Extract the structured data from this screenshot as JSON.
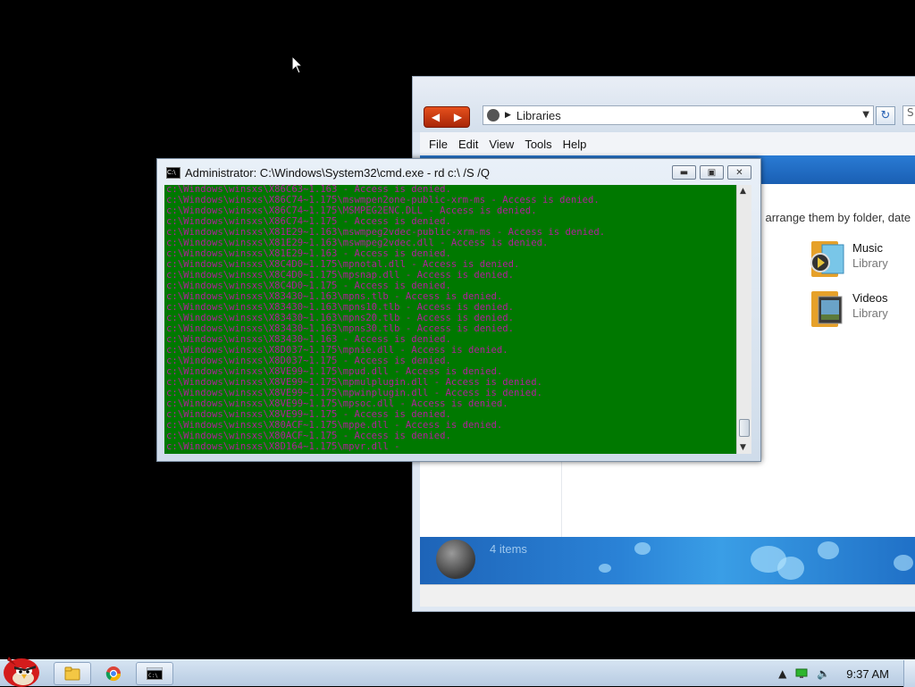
{
  "explorer": {
    "address": "Libraries",
    "search_placeholder": "S",
    "menu": [
      "File",
      "Edit",
      "View",
      "Tools",
      "Help"
    ],
    "hint_text": "l arrange them by folder, date",
    "libraries": [
      {
        "name": "Music",
        "type": "Library"
      },
      {
        "name": "Videos",
        "type": "Library"
      }
    ],
    "items_count": "4 items"
  },
  "cmd": {
    "title": "Administrator: C:\\Windows\\System32\\cmd.exe - rd  c:\\ /S /Q",
    "text_color": "#b0209a",
    "background_color": "#007800",
    "lines": [
      "c:\\Windows\\winsxs\\X86C63~1.163 - Access is denied.",
      "c:\\Windows\\winsxs\\X86C74~1.175\\mswmpen2one-public-xrm-ms - Access is denied.",
      "c:\\Windows\\winsxs\\X86C74~1.175\\MSMPEG2ENC.DLL - Access is denied.",
      "c:\\Windows\\winsxs\\X86C74~1.175 - Access is denied.",
      "c:\\Windows\\winsxs\\X81E29~1.163\\mswmpeg2vdec-public-xrm-ms - Access is denied.",
      "c:\\Windows\\winsxs\\X81E29~1.163\\mswmpeg2vdec.dll - Access is denied.",
      "c:\\Windows\\winsxs\\X81E29~1.163 - Access is denied.",
      "c:\\Windows\\winsxs\\X8C4D0~1.175\\mpnotal.dll - Access is denied.",
      "c:\\Windows\\winsxs\\X8C4D0~1.175\\mpsnap.dll - Access is denied.",
      "c:\\Windows\\winsxs\\X8C4D0~1.175 - Access is denied.",
      "c:\\Windows\\winsxs\\X83430~1.163\\mpns.tlb - Access is denied.",
      "c:\\Windows\\winsxs\\X83430~1.163\\mpns10.tlb - Access is denied.",
      "c:\\Windows\\winsxs\\X83430~1.163\\mpns20.tlb - Access is denied.",
      "c:\\Windows\\winsxs\\X83430~1.163\\mpns30.tlb - Access is denied.",
      "c:\\Windows\\winsxs\\X83430~1.163 - Access is denied.",
      "c:\\Windows\\winsxs\\X8D037~1.175\\mpnie.dll - Access is denied.",
      "c:\\Windows\\winsxs\\X8D037~1.175 - Access is denied.",
      "c:\\Windows\\winsxs\\X8VE99~1.175\\mpud.dll - Access is denied.",
      "c:\\Windows\\winsxs\\X8VE99~1.175\\mpmulplugin.dll - Access is denied.",
      "c:\\Windows\\winsxs\\X8VE99~1.175\\mpwinplugin.dll - Access is denied.",
      "c:\\Windows\\winsxs\\X8VE99~1.175\\mpsoc.dll - Access is denied.",
      "c:\\Windows\\winsxs\\X8VE99~1.175 - Access is denied.",
      "c:\\Windows\\winsxs\\X80ACF~1.175\\mppe.dll - Access is denied.",
      "c:\\Windows\\winsxs\\X80ACF~1.175 - Access is denied.",
      "c:\\Windows\\winsxs\\X8D164~1.175\\mpvr.dll -"
    ]
  },
  "taskbar": {
    "clock": "9:37 AM",
    "apps": [
      "explorer-icon",
      "chrome-icon",
      "cmd-icon"
    ]
  }
}
